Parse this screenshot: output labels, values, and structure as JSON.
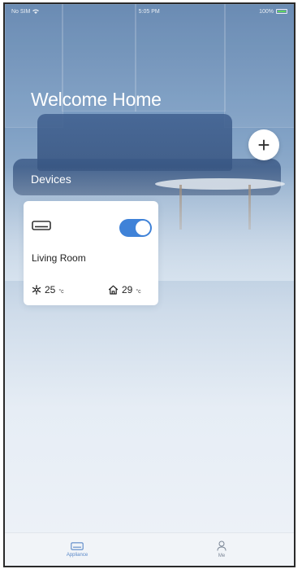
{
  "status_bar": {
    "carrier": "No SIM",
    "time": "5:05 PM",
    "battery_percent": "100%"
  },
  "header": {
    "title": "Welcome Home",
    "add_button_label": "+"
  },
  "devices_section": {
    "title": "Devices",
    "cards": [
      {
        "icon": "air-conditioner-icon",
        "power_on": true,
        "room": "Living Room",
        "set_temperature": "25",
        "set_temperature_unit": "°c",
        "indoor_temperature": "29",
        "indoor_temperature_unit": "°c"
      }
    ]
  },
  "tab_bar": {
    "tabs": [
      {
        "label": "Appliance",
        "icon": "appliance-icon",
        "active": true
      },
      {
        "label": "Me",
        "icon": "person-icon",
        "active": false
      }
    ]
  },
  "colors": {
    "accent": "#3f82d8",
    "background_top": "#6c8fb6",
    "background_bottom": "#eef2f8"
  }
}
